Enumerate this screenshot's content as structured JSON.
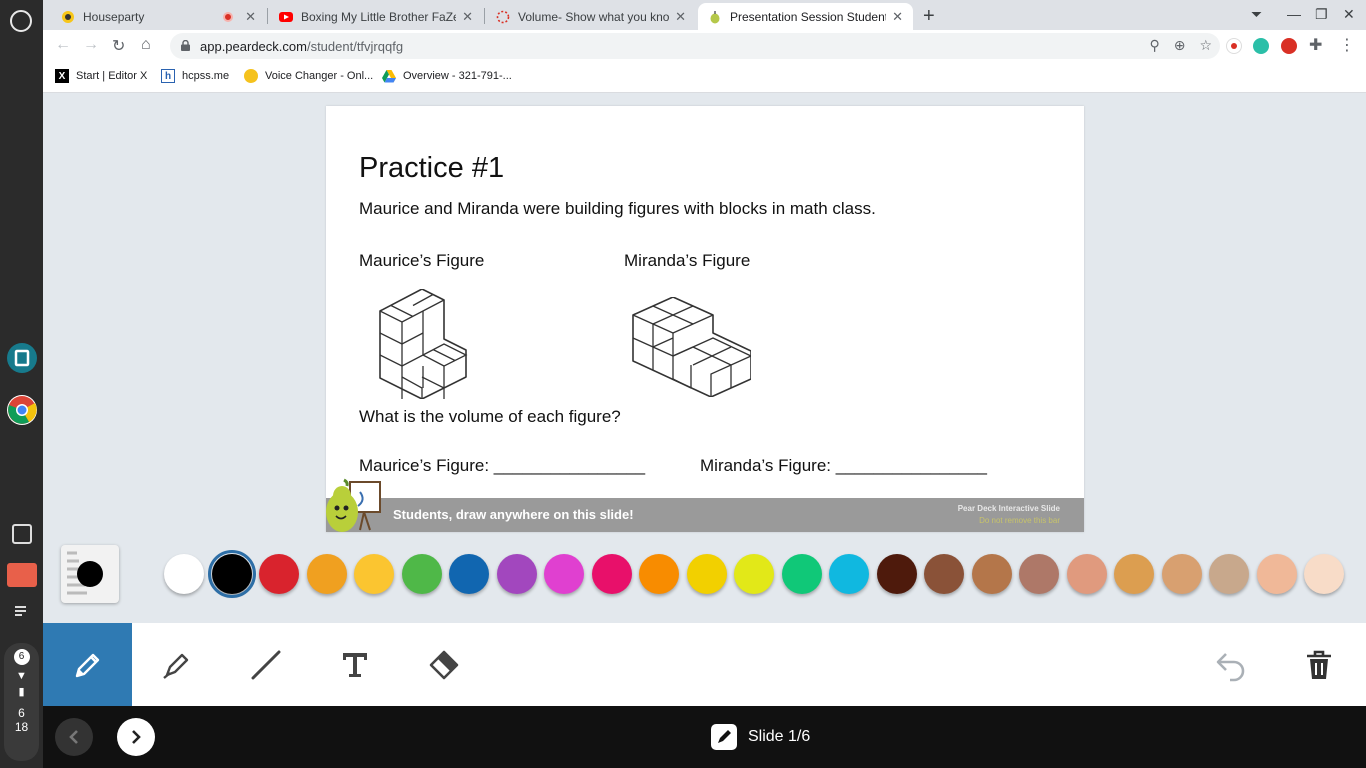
{
  "browser": {
    "tabs": [
      {
        "title": "Houseparty",
        "active": false
      },
      {
        "title": "Boxing My Little Brother FaZe Ja",
        "active": false
      },
      {
        "title": "Volume- Show what you know",
        "active": false
      },
      {
        "title": "Presentation Session Student",
        "active": true
      }
    ],
    "url_domain": "app.peardeck.com",
    "url_path": "/student/tfvjrqqfg",
    "bookmarks": [
      {
        "label": "Start | Editor X",
        "icon": "X"
      },
      {
        "label": "hcpss.me",
        "icon": "h"
      },
      {
        "label": "Voice Changer - Onl...",
        "icon": "v"
      },
      {
        "label": "Overview - 321-791-...",
        "icon": "drive"
      }
    ]
  },
  "shelf": {
    "tray_count": "6",
    "time_hour": "6",
    "time_minute": "18"
  },
  "slide": {
    "title": "Practice #1",
    "intro": "Maurice and Miranda were building figures with blocks in math class.",
    "maurice_heading": "Maurice’s Figure",
    "miranda_heading": "Miranda’s Figure",
    "question": "What is the volume of each figure?",
    "maurice_answer": "Maurice’s Figure: ________________",
    "miranda_answer": "Miranda’s Figure: ________________",
    "footer_text": "Students, draw anywhere on this slide!",
    "footer_right_1": "Pear Deck Interactive Slide",
    "footer_right_2": "Do not remove this bar"
  },
  "palette": {
    "selected": "#000000",
    "colors": [
      "#ffffff",
      "#000000",
      "#d9232d",
      "#f0a020",
      "#fbc530",
      "#4fb848",
      "#1166b0",
      "#a247be",
      "#e040d0",
      "#e8106a",
      "#f88c00",
      "#f2d000",
      "#e2e818",
      "#10c878",
      "#10b8e0",
      "#4e1a0c",
      "#8a5238",
      "#b4764a",
      "#ae7868",
      "#e09a7e",
      "#dc9e50",
      "#d8a070",
      "#c8a88c",
      "#f0b898",
      "#f8dcc8"
    ]
  },
  "tools": {
    "items": [
      "pencil",
      "marker",
      "line",
      "text",
      "eraser"
    ],
    "active": "pencil"
  },
  "navigation": {
    "slide_label": "Slide 1/6"
  }
}
